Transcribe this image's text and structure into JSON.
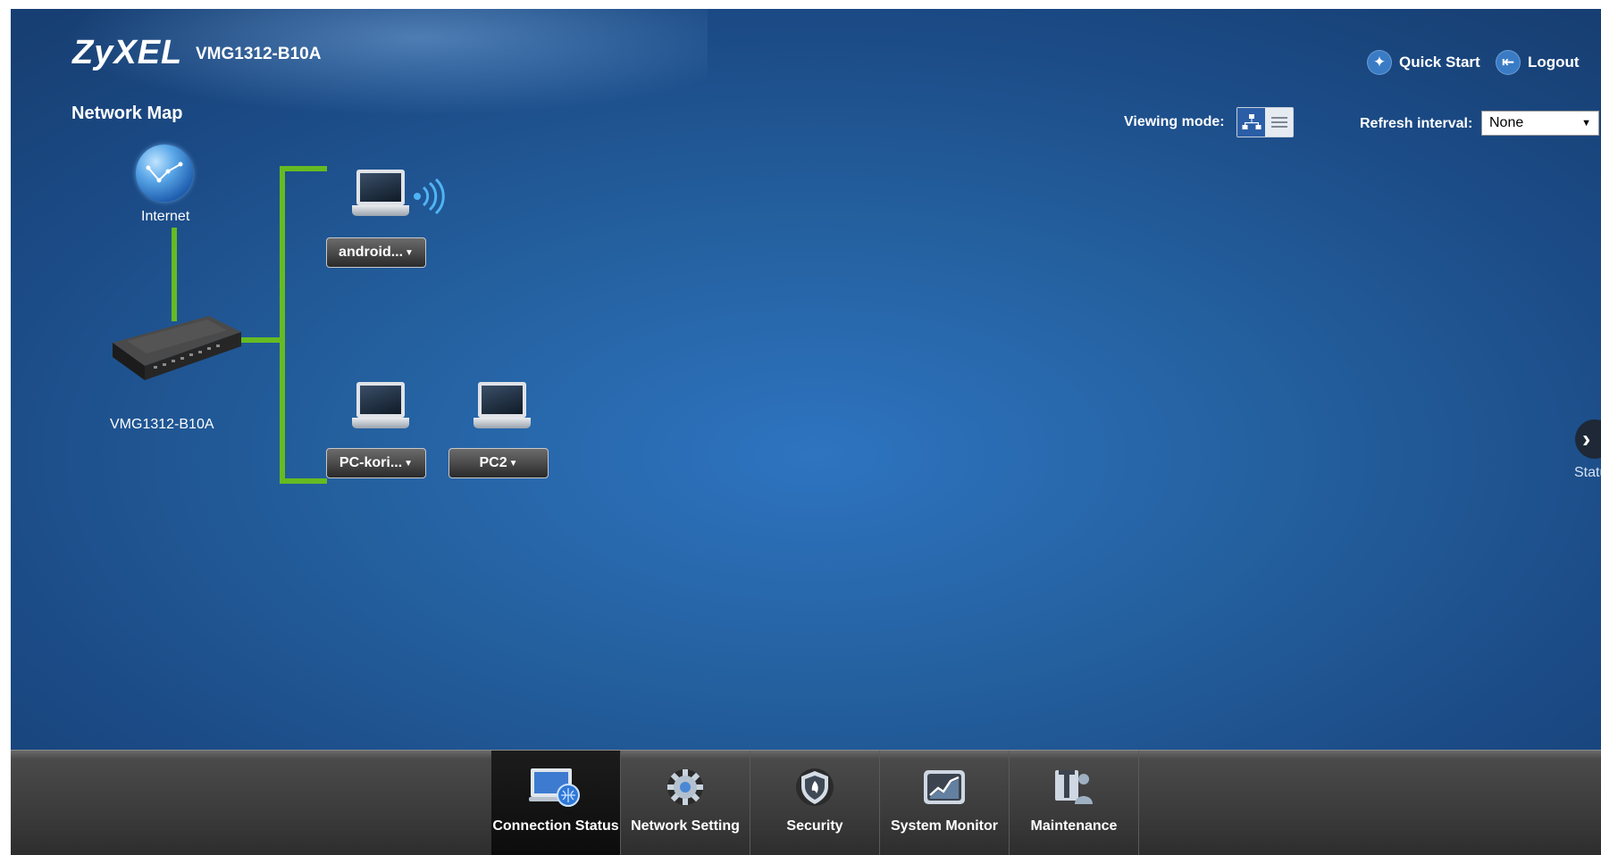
{
  "header": {
    "brand": "ZyXEL",
    "model": "VMG1312-B10A",
    "quick_start_label": "Quick Start",
    "logout_label": "Logout"
  },
  "page": {
    "title": "Network Map"
  },
  "controls": {
    "viewing_mode_label": "Viewing mode:",
    "refresh_label": "Refresh interval:",
    "refresh_value": "None"
  },
  "network_map": {
    "internet_label": "Internet",
    "router_label": "VMG1312-B10A",
    "line_color": "#66bb22",
    "devices": [
      {
        "name": "android...",
        "connection": "wireless"
      },
      {
        "name": "PC-kori...",
        "connection": "wired"
      },
      {
        "name": "PC2",
        "connection": "wired"
      }
    ]
  },
  "status_panel": {
    "label": "Status"
  },
  "bottom_nav": {
    "items": [
      {
        "label": "Connection Status",
        "icon": "connection-status-icon",
        "active": true
      },
      {
        "label": "Network Setting",
        "icon": "gear-icon",
        "active": false
      },
      {
        "label": "Security",
        "icon": "shield-icon",
        "active": false
      },
      {
        "label": "System Monitor",
        "icon": "monitor-chart-icon",
        "active": false
      },
      {
        "label": "Maintenance",
        "icon": "maintenance-icon",
        "active": false
      }
    ]
  },
  "colors": {
    "background": "#24609f",
    "accent_line": "#66bb22",
    "bottom_bar": "#3b3b3b"
  }
}
